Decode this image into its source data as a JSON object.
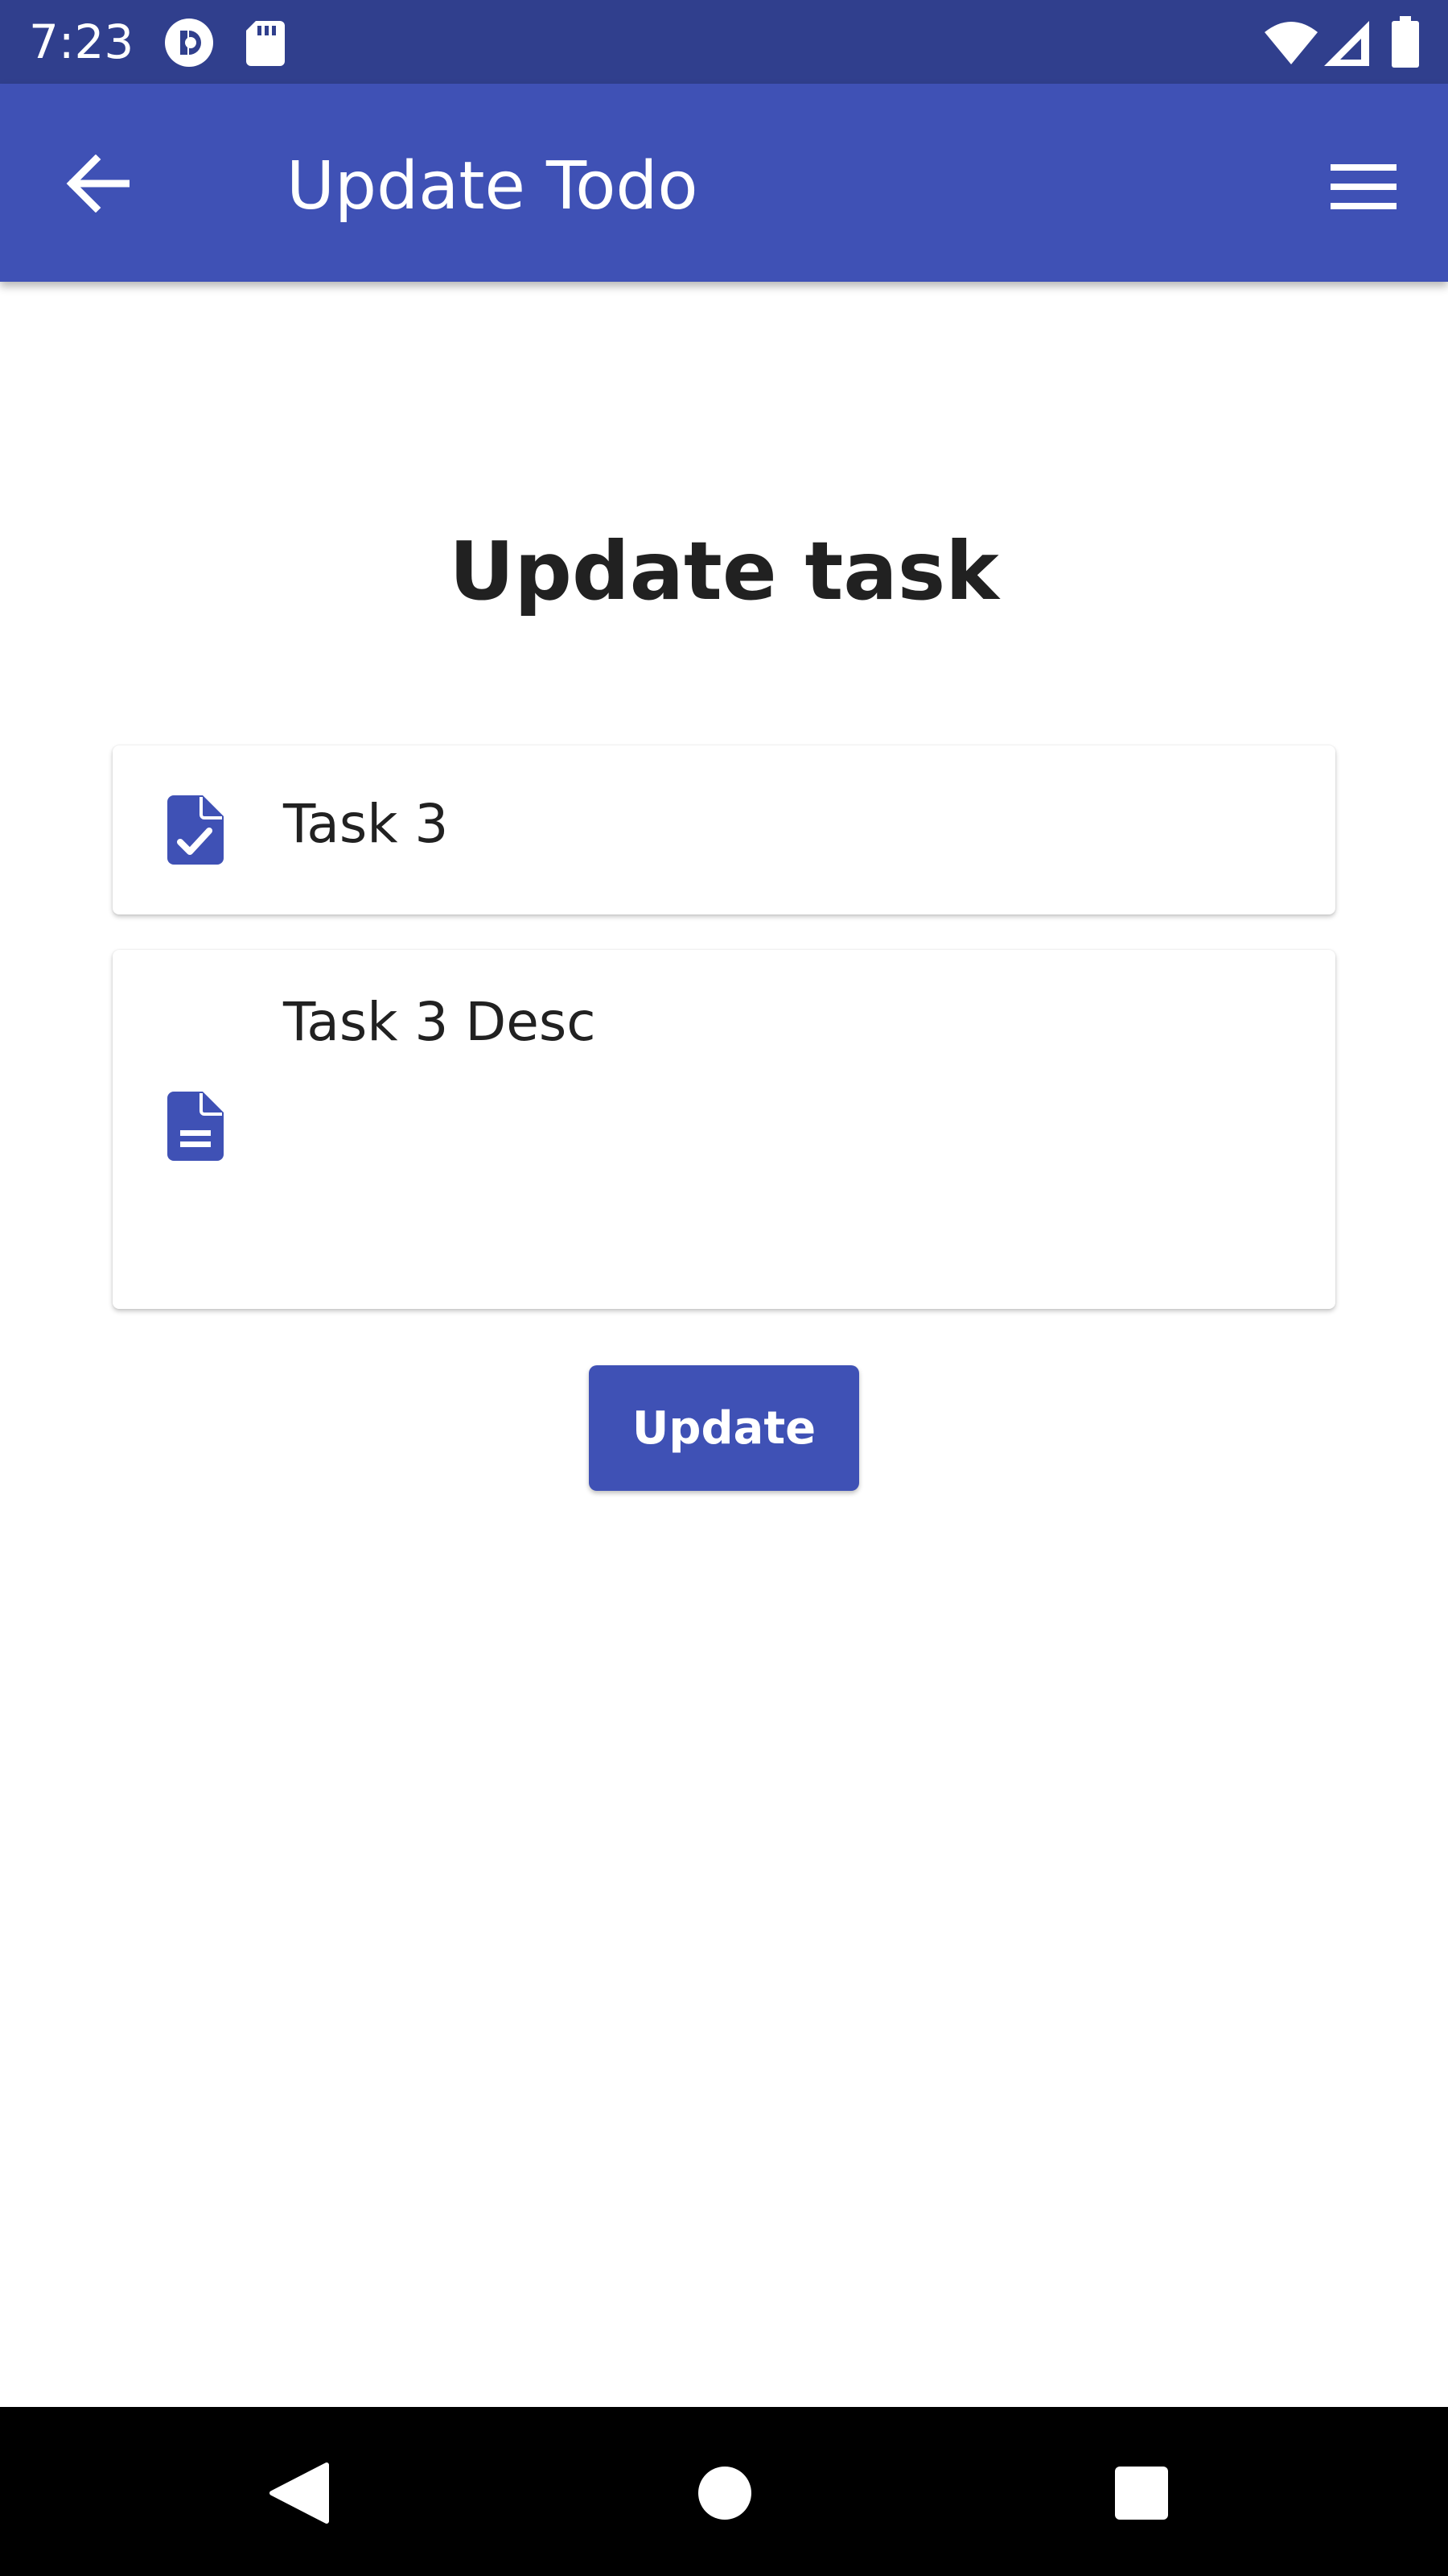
{
  "status_bar": {
    "time": "7:23",
    "icons": [
      "notification-app-icon",
      "sd-card-icon",
      "wifi-icon",
      "cell-signal-icon",
      "battery-icon"
    ]
  },
  "app_bar": {
    "title": "Update Todo",
    "back_icon": "arrow-back-icon",
    "menu_icon": "hamburger-menu-icon"
  },
  "form": {
    "heading": "Update task",
    "title_field": {
      "value": "Task 3",
      "icon": "task-check-document-icon"
    },
    "description_field": {
      "value": "Task 3 Desc",
      "icon": "description-document-icon"
    },
    "submit_label": "Update"
  },
  "nav_bar": {
    "items": [
      "back-triangle-icon",
      "home-circle-icon",
      "recents-square-icon"
    ]
  },
  "colors": {
    "status_bar": "#303F8D",
    "primary": "#3F51B5",
    "text": "#212121",
    "nav_bar": "#000000"
  }
}
